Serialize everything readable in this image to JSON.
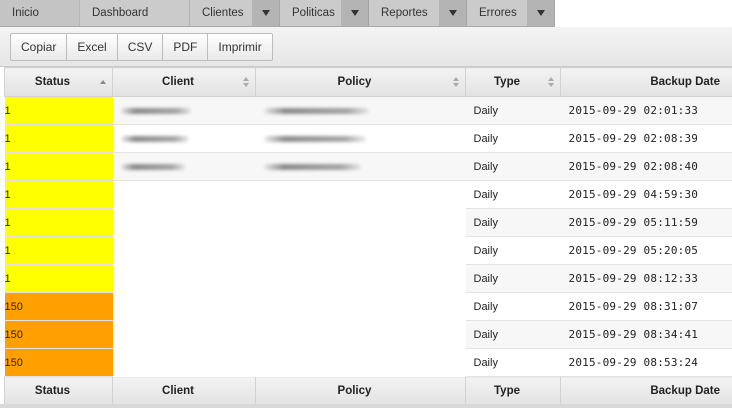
{
  "nav": {
    "home": "Inicio",
    "dashboard": "Dashboard",
    "clientes": "Clientes",
    "politicas": "Politicas",
    "reportes": "Reportes",
    "errores": "Errores"
  },
  "toolbar": {
    "copy": "Copiar",
    "excel": "Excel",
    "csv": "CSV",
    "pdf": "PDF",
    "print": "Imprimir"
  },
  "table": {
    "columns": [
      "Status",
      "Client",
      "Policy",
      "Type",
      "Backup Date"
    ],
    "rows": [
      {
        "status": "1",
        "type": "Daily",
        "date": "2015-09-29 02:01:33",
        "status_color": "#ffff00"
      },
      {
        "status": "1",
        "type": "Daily",
        "date": "2015-09-29 02:08:39",
        "status_color": "#ffff00"
      },
      {
        "status": "1",
        "type": "Daily",
        "date": "2015-09-29 02:08:40",
        "status_color": "#ffff00"
      },
      {
        "status": "1",
        "type": "Daily",
        "date": "2015-09-29 04:59:30",
        "status_color": "#ffff00"
      },
      {
        "status": "1",
        "type": "Daily",
        "date": "2015-09-29 05:11:59",
        "status_color": "#ffff00"
      },
      {
        "status": "1",
        "type": "Daily",
        "date": "2015-09-29 05:20:05",
        "status_color": "#ffff00"
      },
      {
        "status": "1",
        "type": "Daily",
        "date": "2015-09-29 08:12:33",
        "status_color": "#ffff00"
      },
      {
        "status": "150",
        "type": "Daily",
        "date": "2015-09-29 08:31:07",
        "status_color": "#ff9f00"
      },
      {
        "status": "150",
        "type": "Daily",
        "date": "2015-09-29 08:34:41",
        "status_color": "#ff9f00"
      },
      {
        "status": "150",
        "type": "Daily",
        "date": "2015-09-29 08:53:24",
        "status_color": "#ff9f00"
      }
    ]
  }
}
